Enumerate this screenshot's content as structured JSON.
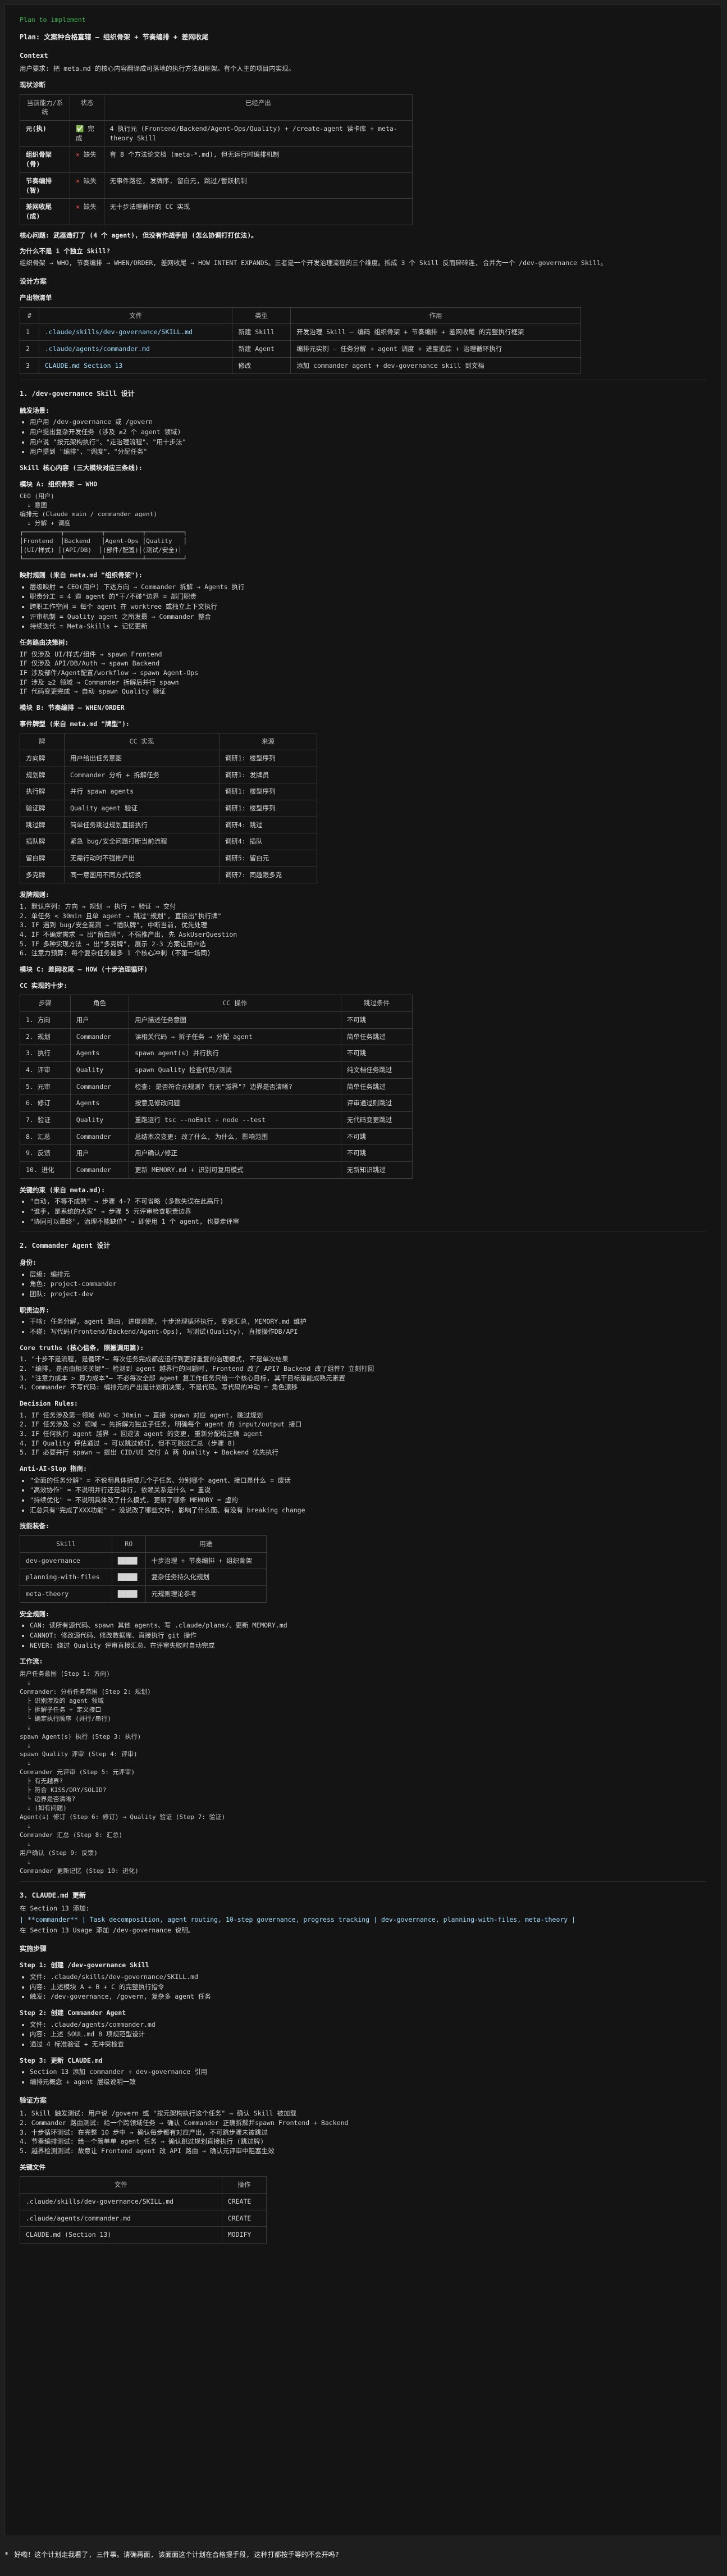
{
  "header": {
    "plan_label": "Plan to implement"
  },
  "title": "Plan: 文案种合格直辖 — 组织骨架 + 节奏编排 + 差网收尾",
  "context": {
    "heading": "Context",
    "intro": "用户要求: 把 meta.md 的核心内容翻译成可落地的执行方法和框架。有个人主的项目内实现。",
    "status_heading": "现状诊断",
    "status_table": {
      "headers": [
        "当前能力/系统",
        "状态",
        "已经产出"
      ],
      "rows": [
        {
          "name": "元(执)",
          "status": "完成",
          "status_kind": "ok",
          "note": "4 执行元 (Frontend/Backend/Agent-Ops/Quality) + /create-agent 读卡库 + meta-theory Skill"
        },
        {
          "name": "组织骨架(骨)",
          "status": "缺失",
          "status_kind": "bad",
          "note": "有 8 个方法论文档 (meta-*.md), 但无运行时编排机制"
        },
        {
          "name": "节奏编排(智)",
          "status": "缺失",
          "status_kind": "bad",
          "note": "无事件路径, 发牌序, 留白元, 跳过/暂跃机制"
        },
        {
          "name": "差网收尾(成)",
          "status": "缺失",
          "status_kind": "bad",
          "note": "无十步法理循环的 CC 实现"
        }
      ]
    },
    "core_issue": "核心问题: 武器造打了 (4 个 agent), 但没有作战手册 (怎么协调打打仗法)。",
    "why_heading": "为什么不是 1 个独立 Skill?",
    "why_text": "组织骨架 → WHO, 节奏编排 → WHEN/ORDER, 差网收尾 → HOW INTENT EXPANDS。三者是一个开发治理流程的三个维度。拆成 3 个 Skill 反而碎碎连, 合并为一个 /dev-governance Skill。"
  },
  "design": {
    "heading": "设计方案",
    "files_heading": "产出物清单",
    "files_table": {
      "headers": [
        "#",
        "文件",
        "类型",
        "作用"
      ],
      "rows": [
        {
          "n": "1",
          "file": ".claude/skills/dev-governance/SKILL.md",
          "type": "新建 Skill",
          "role": "开发治理 Skill — 编码 组织骨架 + 节奏编排 + 差网收尾 的完整执行框架"
        },
        {
          "n": "2",
          "file": ".claude/agents/commander.md",
          "type": "新建 Agent",
          "role": "编排元实例 — 任务分解 + agent 调度 + 进度追踪 + 治理循环执行"
        },
        {
          "n": "3",
          "file": "CLAUDE.md Section 13",
          "type": "修改",
          "role": "添加 commander agent + dev-governance skill 到文档"
        }
      ]
    }
  },
  "skill_design": {
    "heading": "1. /dev-governance Skill 设计",
    "trigger_heading": "触发场景:",
    "triggers": [
      "用户用 /dev-governance 或 /govern",
      "用户提出复杂开发任务 (涉及 ≥2 个 agent 领域)",
      "用户说 \"按元架构执行\"、\"走治理流程\"、\"用十步法\"",
      "用户提到 \"编排\"、\"调度\"、\"分配任务\""
    ],
    "core_struct": "Skill 核心内容 (三大模块对应三条线):",
    "module_a": {
      "heading": "模块 A: 组织骨架 — WHO",
      "tree": "CEO (用户)\n  ↓ 意图\n编排元 (Claude main / commander agent)\n  ↓ 分解 + 调度\n┌──────────┬──────────┬──────────┬──────────┐\n│Frontend  │Backend   │Agent-Ops │Quality   │\n│(UI/样式) │(API/DB)  │(部件/配置)│(测试/安全)│\n└──────────┴──────────┴──────────┴──────────┘",
      "mapping_heading": "映射规则 (来自 meta.md \"组织骨架\"):",
      "mapping": [
        "层级映射 = CEO(用户) 下达方向 → Commander 拆解 → Agents 执行",
        "职责分工 = 4 道 agent 的\"干/不碰\"边界 = 部门职责",
        "跨职工作空间 = 每个 agent 在 worktree 或独立上下文执行",
        "评审机制 = Quality agent 之所发最 → Commander 整合",
        "持续迭代 = Meta-Skills + 记忆更新"
      ],
      "dispatch_heading": "任务路由决策树:",
      "dispatch": [
        "IF 仅涉及 UI/样式/组件 → spawn Frontend",
        "IF 仅涉及 API/DB/Auth → spawn Backend",
        "IF 涉及部件/Agent配置/workflow → spawn Agent-Ops",
        "IF 涉及 ≥2 领域 → Commander 拆解后并行 spawn",
        "IF 代码变更完成 → 自动 spawn Quality 验证"
      ]
    },
    "module_b": {
      "heading": "模块 B: 节奏编排 — WHEN/ORDER",
      "event_heading": "事件牌型 (来自 meta.md \"牌型\"):",
      "event_table": {
        "headers": [
          "牌",
          "CC 实现",
          "来源"
        ],
        "rows": [
          [
            "方向牌",
            "用户给出任务意图",
            "调研1: 楼型序列"
          ],
          [
            "规划牌",
            "Commander 分析 + 拆解任务",
            "调研1: 发牌员"
          ],
          [
            "执行牌",
            "并行 spawn agents",
            "调研1: 楼型序列"
          ],
          [
            "验证牌",
            "Quality agent 验证",
            "调研1: 楼型序列"
          ],
          [
            "跳过牌",
            "简单任务跳过规划直接执行",
            "调研4: 跳过"
          ],
          [
            "插队牌",
            "紧急 bug/安全问题打断当前流程",
            "调研4: 插队"
          ],
          [
            "留白牌",
            "无需行动时不强推产出",
            "调研5: 留白元"
          ],
          [
            "多克牌",
            "同一意图用不同方式切换",
            "调研7: 同趣跟多克"
          ]
        ]
      },
      "rules_heading": "发牌规则:",
      "rules": [
        "1. 默认序列: 方向 → 规划 → 执行 → 验证 → 交付",
        "2. 单任务 < 30min 且单 agent → 跳过\"规划\", 直接出\"执行牌\"",
        "3. IF 遇到 bug/安全漏洞 → \"插队牌\", 中断当前, 优先处理",
        "4. IF 不确定需求 → 出\"留白牌\", 不强推产出, 先 AskUserQuestion",
        "5. IF 多种实现方法 → 出\"多克牌\", 展示 2-3 方案让用户选",
        "6. 注意力预算: 每个复杂任务最多 1 个核心冲刺 (不第一场同)"
      ]
    },
    "module_c": {
      "heading": "模块 C: 差网收尾 — HOW (十步治理循环)",
      "subheading": "CC 实现的十步:",
      "steps_table": {
        "headers": [
          "步骤",
          "角色",
          "CC 操作",
          "跳过条件"
        ],
        "rows": [
          [
            "1. 方向",
            "用户",
            "用户描述任务意图",
            "不可跳"
          ],
          [
            "2. 规划",
            "Commander",
            "读相关代码 → 拆子任务 → 分配 agent",
            "简单任务跳过"
          ],
          [
            "3. 执行",
            "Agents",
            "spawn agent(s) 并行执行",
            "不可跳"
          ],
          [
            "4. 评审",
            "Quality",
            "spawn Quality 检查代码/测试",
            "纯文档任务跳过"
          ],
          [
            "5. 元审",
            "Commander",
            "检查: 是否符合元规则? 有无\"越界\"? 边界是否清晰?",
            "简单任务跳过"
          ],
          [
            "6. 修订",
            "Agents",
            "按意见修改问题",
            "评审通过则跳过"
          ],
          [
            "7. 验证",
            "Quality",
            "重跑运行 tsc --noEmit + node --test",
            "无代码变更跳过"
          ],
          [
            "8. 汇总",
            "Commander",
            "总结本次变更: 改了什么, 为什么, 影响范围",
            "不可跳"
          ],
          [
            "9. 反馈",
            "用户",
            "用户确认/修正",
            "不可跳"
          ],
          [
            "10. 进化",
            "Commander",
            "更新 MEMORY.md + 识别可复用模式",
            "无新知识跳过"
          ]
        ]
      },
      "key_heading": "关键约束 (来自 meta.md):",
      "key": [
        "\"自动, 不等不成熟\" → 步骤 4-7 不可省略 (多数失误在此高斤)",
        "\"谁手, 是系统的大家\" → 步骤 5 元评审检查职责边界",
        "\"协同可以最终\", 治理不能缺位\" → 即使用 1 个 agent, 也要走评审"
      ]
    }
  },
  "commander": {
    "heading": "2. Commander Agent 设计",
    "role_heading": "身份:",
    "role": [
      "层级: 编排元",
      "角色: project-commander",
      "团队: project-dev"
    ],
    "duty_heading": "职责边界:",
    "duty": [
      "干啥: 任务分解, agent 路由, 进度追踪, 十步治理循环执行, 变更汇总, MEMORY.md 维护",
      "不碰: 写代码(Frontend/Backend/Agent-Ops), 写测试(Quality), 直接操作DB/API"
    ],
    "truths_heading": "Core truths (核心信条, 照搬调用篇):",
    "truths": [
      "1. \"十步不是流程, 是循环\"— 每次任务完成都应运行到更好重复的治理模式, 不是单次结果",
      "2. \"编排, 是否由相关关键\"— 检测到 agent 越界行的问题时, Frontend 改了 API? Backend 改了组件? 立刻打回",
      "3. \"注意力成本 > 算力成本\"— 不必每次全部 agent 复工作任务只给一个核心目标, 其干目标是能成熟元素置",
      "4. Commander 不写代码: 编排元的产出是计划和决策, 不是代码。写代码的冲动 = 角色漂移"
    ],
    "decision_heading": "Decision Rules:",
    "decision": [
      "1. IF 任务涉及第一领域 AND < 30min → 直接 spawn 对应 agent, 跳过规划",
      "2. IF 任务涉及 ≥2 领域 → 先拆解为独立子任务, 明确每个 agent 的 input/output 接口",
      "3. IF 任何执行 agent 越界 → 回退该 agent 的变更, 重新分配给正确 agent",
      "4. IF Quality 评估通过 → 可以跳过修订, 但不可跳过汇总 (步骤 8)",
      "5. IF 必要并行 spawn → 提出 CID/UI 交付 A 两 Quality + Backend 优先执行"
    ],
    "anti_heading": "Anti-AI-Slop 指南:",
    "anti": [
      "\"全面的任务分解\" = 不说明具体拆成几个子任务、分别哪个 agent、接口是什么 = 废话",
      "\"高效协作\" = 不说明并行还是串行, 依赖关系是什么 = 重说",
      "\"持续优化\" = 不说明具体改了什么模式, 更新了哪条 MEMORY = 虚的",
      "汇总只有\"完成了XXX功能\" = 没说改了哪些文件, 影响了什么面、有没有 breaking change"
    ],
    "skills_heading": "技能装备:",
    "skills_table": {
      "headers": [
        "Skill",
        "RO",
        "用途"
      ],
      "rows": [
        [
          "dev-governance",
          "█████",
          "十步治理 + 节奏编排 + 组织骨架"
        ],
        [
          "planning-with-files",
          "█████",
          "复杂任务持久化规划"
        ],
        [
          "meta-theory",
          "█████",
          "元规则理论参考"
        ]
      ]
    },
    "security_heading": "安全规则:",
    "security": [
      "CAN: 读所有源代码、spawn 其他 agents、写 .claude/plans/、更新 MEMORY.md",
      "CANNOT: 修改源代码、修改数据库、直接执行 git 操作",
      "NEVER: 绕过 Quality 评审直接汇总、在评审失败时自动完成"
    ],
    "flow_heading": "工作流:",
    "flow": "用户任务意图 (Step 1: 方向)\n  ↓\nCommander: 分析任务范围 (Step 2: 规划)\n  ├ 识别涉及的 agent 领域\n  ├ 拆解子任务 + 定义接口\n  └ 确定执行顺序 (并行/串行)\n  ↓\nspawn Agent(s) 执行 (Step 3: 执行)\n  ↓\nspawn Quality 评审 (Step 4: 评审)\n  ↓\nCommander 元评审 (Step 5: 元评审)\n  ├ 有无越界?\n  ├ 符合 KISS/DRY/SOLID?\n  └ 边界是否清晰?\n  ↓ (如有问题)\nAgent(s) 修订 (Step 6: 修订) → Quality 验证 (Step 7: 验证)\n  ↓\nCommander 汇总 (Step 8: 汇总)\n  ↓\n用户确认 (Step 9: 反馈)\n  ↓\nCommander 更新记忆 (Step 10: 进化)"
  },
  "claude_md": {
    "heading": "3. CLAUDE.md 更新",
    "text1": "在 Section 13 添加:",
    "row": "| **commander** | Task decomposition, agent routing, 10-step governance, progress tracking | dev-governance, planning-with-files, meta-theory |",
    "text2": "在 Section 13 Usage 添加 /dev-governance 说明。"
  },
  "impl": {
    "heading": "实施步骤",
    "step1_heading": "Step 1: 创建 /dev-governance Skill",
    "step1": [
      "文件: .claude/skills/dev-governance/SKILL.md",
      "内容: 上述模块 A + B + C 的完整执行指令",
      "触发: /dev-governance, /govern, 复杂多 agent 任务"
    ],
    "step2_heading": "Step 2: 创建 Commander Agent",
    "step2": [
      "文件: .claude/agents/commander.md",
      "内容: 上述 SOUL.md 8 项规范型设计",
      "通过 4 标准验证 + 无冲突检查"
    ],
    "step3_heading": "Step 3: 更新 CLAUDE.md",
    "step3": [
      "Section 13 添加 commander + dev-governance 引用",
      "编排元概念 + agent 层级说明一致"
    ]
  },
  "verify": {
    "heading": "验证方案",
    "items": [
      "1. Skill 触发测试: 用户说 /govern 或 \"按元架构执行这个任务\" → 确认 Skill 被加载",
      "2. Commander 路由测试: 给一个跨领域任务 → 确认 Commander 正确拆解并spawn Frontend + Backend",
      "3. 十步循环测试: 在完整 10 步中 → 确认每步都有对应产出, 不可跳步骤未被跳过",
      "4. 节奏编排测试: 给一个简单单 agent 任务 → 确认跳过规划直接执行 (跳过牌)",
      "5. 越界检测测试: 故意让 Frontend agent 改 API 路由 → 确认元评审中阻塞生效"
    ],
    "files_heading": "关键文件",
    "files_table": {
      "headers": [
        "文件",
        "操作"
      ],
      "rows": [
        [
          ".claude/skills/dev-governance/SKILL.md",
          "CREATE"
        ],
        [
          ".claude/agents/commander.md",
          "CREATE"
        ],
        [
          "CLAUDE.md (Section 13)",
          "MODIFY"
        ]
      ]
    }
  },
  "bottom": {
    "bullet": "*",
    "question": "好嘞！这个计划走我看了, 三件事。请确再面, 该面面这个计划在合格提手段, 这种打都按手等的不会开吗?"
  }
}
